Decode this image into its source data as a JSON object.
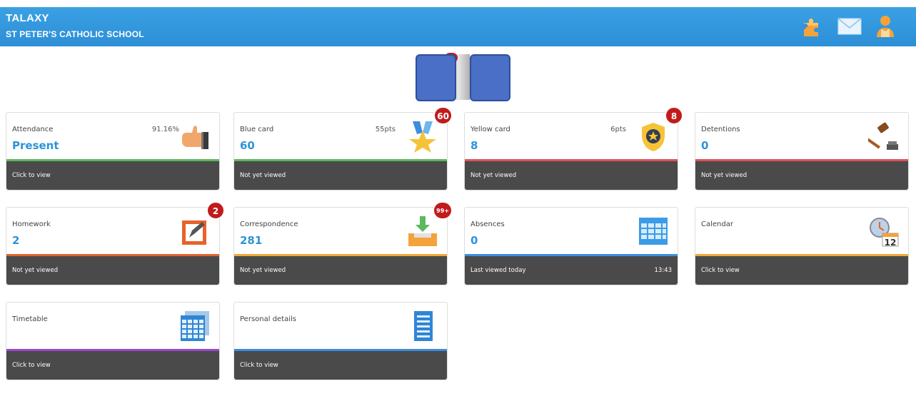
{
  "header": {
    "app_name": "TALAXY",
    "school_name": "ST PETER'S CATHOLIC SCHOOL",
    "icons": [
      "puzzle-icon",
      "mail-icon",
      "user-icon"
    ]
  },
  "cards": [
    {
      "title": "Attendance",
      "pts": "91.16%",
      "value": "Present",
      "footer": "Click to view",
      "accent": "#5cb85c",
      "icon": "thumbs-up-icon"
    },
    {
      "title": "Blue card",
      "pts": "55pts",
      "value": "60",
      "footer": "Not yet viewed",
      "accent": "#5cb85c",
      "icon": "medal-icon",
      "badge": "60"
    },
    {
      "title": "Yellow card",
      "pts": "6pts",
      "value": "8",
      "footer": "Not yet viewed",
      "accent": "#e0525a",
      "icon": "police-badge-icon",
      "badge": "8"
    },
    {
      "title": "Detentions",
      "value": "0",
      "footer": "Not yet viewed",
      "accent": "#e0525a",
      "icon": "gavel-icon"
    },
    {
      "title": "Homework",
      "value": "2",
      "footer": "Not yet viewed",
      "accent": "#e0642c",
      "icon": "homework-icon",
      "badge": "2"
    },
    {
      "title": "Correspondence",
      "value": "281",
      "footer": "Not yet viewed",
      "accent": "#f0a93a",
      "icon": "inbox-download-icon",
      "badge": "99+"
    },
    {
      "title": "Absences",
      "value": "0",
      "footer": "Last viewed today",
      "footer_time": "13:43",
      "accent": "#3b8de0",
      "icon": "calendar-grid-icon"
    },
    {
      "title": "Calendar",
      "footer": "Click to view",
      "accent": "#f0a93a",
      "icon": "calendar-clock-icon",
      "icon_number": "12"
    },
    {
      "title": "Timetable",
      "footer": "Click to view",
      "accent": "#9b47d1",
      "icon": "timetable-icon"
    },
    {
      "title": "Personal details",
      "footer": "Click to view",
      "accent": "#3b8de0",
      "icon": "document-icon"
    }
  ]
}
